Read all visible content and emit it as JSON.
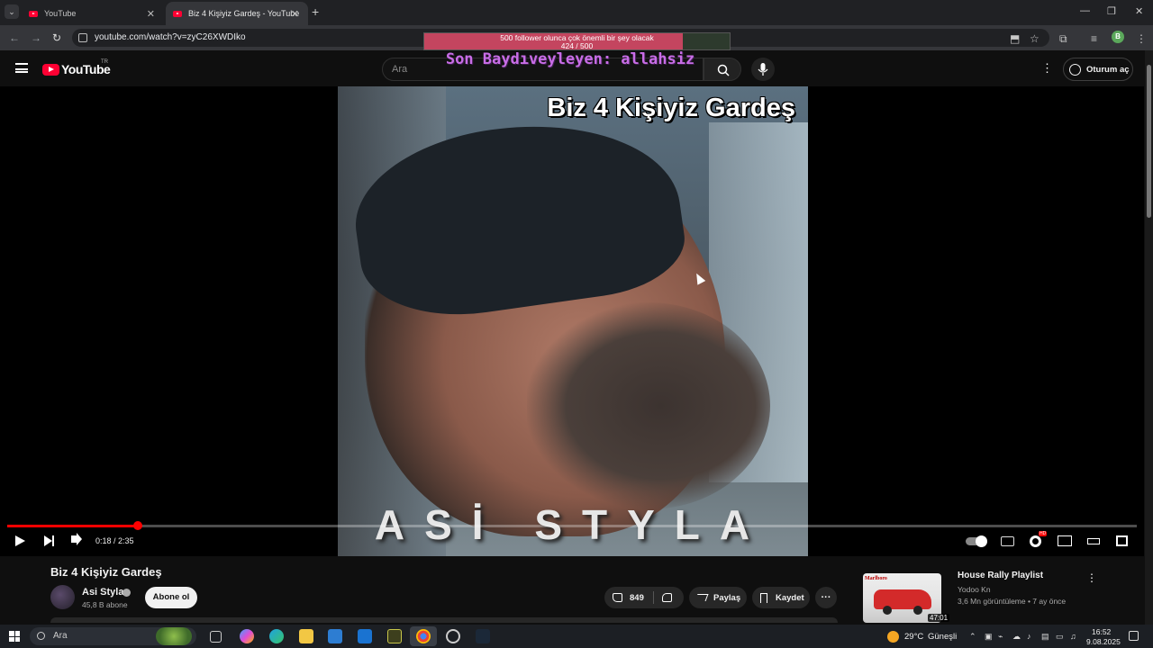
{
  "browser": {
    "tabs": [
      {
        "label": "YouTube",
        "active": false
      },
      {
        "label": "Biz 4 Kişiyiz Gardeş - YouTube",
        "active": true
      }
    ],
    "url": "youtube.com/watch?v=zyC26XWDIko",
    "profile_initial": "B"
  },
  "goal_overlay": {
    "line1": "500 follower olunca çok önemli bir şey olacak",
    "line2": "424 / 500",
    "current": 424,
    "target": 500
  },
  "stream_overlay": {
    "text": "Son Baydıveyleyen: allahsiz"
  },
  "youtube_header": {
    "logo_text": "YouTube",
    "country": "TR",
    "search_placeholder": "Ara",
    "signin_label": "Oturum aç"
  },
  "player": {
    "caption_text": "Biz 4 Kişiyiz Gardeş",
    "artist_text": "ASİ STYLA",
    "time_current": "0:18",
    "time_total": "2:35",
    "timecode": "0:18 / 2:35",
    "progress_fraction": 0.116,
    "hd_badge": "HD"
  },
  "video_info": {
    "title": "Biz 4 Kişiyiz Gardeş",
    "channel_name": "Asi Styla",
    "subscribers": "45,8 B abone",
    "subscribe_label": "Abone ol",
    "likes": "849",
    "share_label": "Paylaş",
    "save_label": "Kaydet",
    "more_label": "···"
  },
  "recommendation": {
    "title": "House Rally Playlist",
    "channel": "Yodoo Kn",
    "meta": "3,6 Mn görüntüleme • 7 ay önce",
    "duration": "47:01",
    "thumb_brand": "Marlboro"
  },
  "taskbar": {
    "search_label": "Ara",
    "weather_temp": "29°C",
    "weather_condition": "Güneşli",
    "time": "16:52",
    "date": "9.08.2025"
  },
  "colors": {
    "youtube_red": "#ff0033",
    "progress_red": "#ff0000",
    "overlay_purple": "#c86de6",
    "goal_pink": "#c4455f"
  }
}
